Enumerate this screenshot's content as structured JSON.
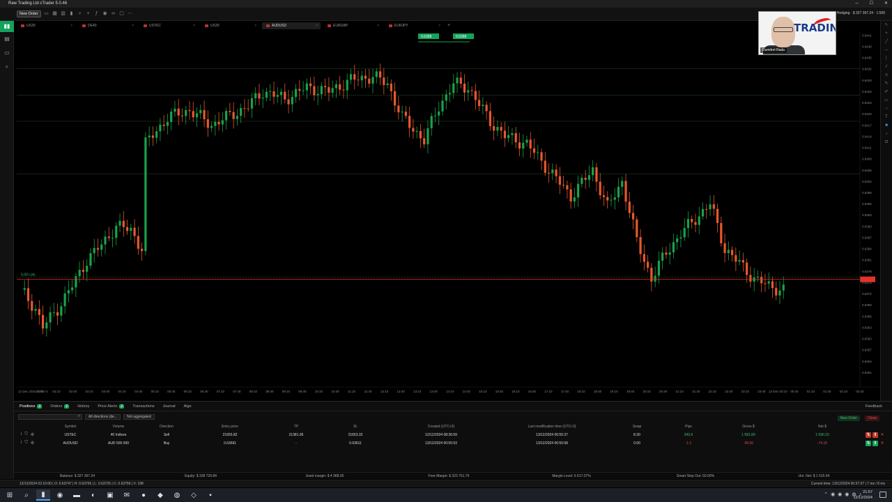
{
  "window": {
    "title": "Raw Trading Ltd cTrader 5.0.46"
  },
  "toolbar": {
    "new_order_label": "New Order",
    "account_text": "Hedging · $ 327 397.24 · 1:500"
  },
  "tabs": [
    {
      "label": "US30",
      "active": false
    },
    {
      "label": "DE40",
      "active": false
    },
    {
      "label": "USTEC",
      "active": false
    },
    {
      "label": "US30",
      "active": false
    },
    {
      "label": "AUDUSD",
      "active": true
    },
    {
      "label": "EURGBP",
      "active": false
    },
    {
      "label": "EURJPY",
      "active": false
    }
  ],
  "webcam": {
    "name_tag": "Dumitrel Rada",
    "logo_text": "TRADING"
  },
  "chart_data": {
    "type": "candlestick",
    "symbol": "AUDUSD",
    "bar_count": 208,
    "ylim": [
      0.6348,
      0.6442
    ],
    "color_up": "#17a34a",
    "color_down": "#e8582e",
    "current_price_line": 0.63758,
    "price_labels": [
      "0.6441",
      "0.6438",
      "0.6435",
      "0.6432",
      "0.6429",
      "0.6426",
      "0.6423",
      "0.6420",
      "0.6417",
      "0.6414",
      "0.6411",
      "0.6408",
      "0.6405",
      "0.6402",
      "0.6399",
      "0.6396",
      "0.6393",
      "0.6390",
      "0.6387",
      "0.6384",
      "0.6381",
      "0.6378",
      "0.6375",
      "0.6372",
      "0.6369",
      "0.6366",
      "0.6363",
      "0.6360",
      "0.6357",
      "0.6354",
      "0.6351"
    ],
    "time_labels": [
      "12 Dec 2024, UTC+3",
      "01:40",
      "02:10",
      "02:40",
      "03:10",
      "03:40",
      "04:10",
      "04:40",
      "05:10",
      "05:40",
      "06:10",
      "06:40",
      "07:10",
      "07:40",
      "08:10",
      "08:40",
      "09:10",
      "09:40",
      "10:10",
      "10:40",
      "11:10",
      "11:40",
      "12:10",
      "12:40",
      "13:10",
      "13:40",
      "14:10",
      "14:40",
      "15:10",
      "15:40",
      "16:10",
      "16:40",
      "17:10",
      "17:40",
      "18:10",
      "18:40",
      "19:10",
      "19:40",
      "20:10",
      "20:40",
      "21:10",
      "21:40",
      "22:10",
      "22:40",
      "23:10",
      "23:40",
      "13 Dec 00:10",
      "00:40",
      "01:10",
      "01:40",
      "02:10",
      "02:40"
    ],
    "order_line_label": "5.00 Lots",
    "order_tags": [
      "0.6368",
      "0.6368"
    ],
    "anchors": [
      [
        0,
        0.6373
      ],
      [
        4,
        0.6368
      ],
      [
        6,
        0.6363
      ],
      [
        10,
        0.6368
      ],
      [
        14,
        0.6374
      ],
      [
        18,
        0.6381
      ],
      [
        22,
        0.6385
      ],
      [
        26,
        0.639
      ],
      [
        30,
        0.6389
      ],
      [
        33,
        0.6384
      ],
      [
        34,
        0.6412
      ],
      [
        40,
        0.6419
      ],
      [
        46,
        0.6421
      ],
      [
        52,
        0.6417
      ],
      [
        58,
        0.642
      ],
      [
        62,
        0.6422
      ],
      [
        66,
        0.6426
      ],
      [
        72,
        0.6424
      ],
      [
        78,
        0.6427
      ],
      [
        84,
        0.6426
      ],
      [
        90,
        0.6429
      ],
      [
        96,
        0.643
      ],
      [
        100,
        0.6428
      ],
      [
        104,
        0.6419
      ],
      [
        110,
        0.6413
      ],
      [
        114,
        0.6422
      ],
      [
        118,
        0.6428
      ],
      [
        122,
        0.6427
      ],
      [
        128,
        0.6418
      ],
      [
        132,
        0.6414
      ],
      [
        138,
        0.6412
      ],
      [
        144,
        0.6405
      ],
      [
        150,
        0.6398
      ],
      [
        156,
        0.6405
      ],
      [
        160,
        0.6395
      ],
      [
        164,
        0.6402
      ],
      [
        168,
        0.6386
      ],
      [
        172,
        0.6376
      ],
      [
        176,
        0.6383
      ],
      [
        180,
        0.6388
      ],
      [
        184,
        0.6392
      ],
      [
        188,
        0.6396
      ],
      [
        192,
        0.6384
      ],
      [
        196,
        0.638
      ],
      [
        200,
        0.6376
      ],
      [
        204,
        0.6374
      ],
      [
        208,
        0.6373
      ],
      [
        212,
        0.6365
      ],
      [
        216,
        0.6361
      ],
      [
        220,
        0.6363
      ],
      [
        224,
        0.636
      ],
      [
        228,
        0.6364
      ],
      [
        232,
        0.6369
      ]
    ]
  },
  "panel": {
    "tabs": [
      {
        "label": "Positions",
        "count": "2"
      },
      {
        "label": "Orders",
        "count": "2"
      },
      {
        "label": "History",
        "count": ""
      },
      {
        "label": "Price Alerts",
        "count": "2"
      },
      {
        "label": "Transactions",
        "count": ""
      },
      {
        "label": "Journal",
        "count": ""
      },
      {
        "label": "Algo",
        "count": ""
      }
    ],
    "feedback": "Feedback",
    "filter_direction": "All directions (de...",
    "filter_aggregation": "Not aggregated",
    "new_order_label": "New Order",
    "close_label": "Close",
    "columns": [
      "Symbol",
      "Volume",
      "Direction",
      "Entry price",
      "TP",
      "SL",
      "Created (UTC+3)",
      "Last modification time (UTC+3)",
      "Swap",
      "Pips",
      "Gross $",
      "Net $"
    ],
    "rows": [
      {
        "symbol": "USTEC",
        "volume": "40 Indices",
        "direction": "Sell",
        "entry": "21655.82",
        "tp": "21381.95",
        "sl": "21653.32",
        "created": "12/12/2024 08:36:59",
        "modified": "13/12/2024 00:55:37",
        "swap": "8.30",
        "pips": "343.6",
        "gross": "1 581.80",
        "net": "1 590.10",
        "pos": true
      },
      {
        "symbol": "AUDUSD",
        "volume": "AUD 500 000",
        "direction": "Buy",
        "entry": "0.63691",
        "tp": "-",
        "sl": "0.63611",
        "created": "13/12/2024 00:55:53",
        "modified": "13/12/2024 00:55:58",
        "swap": "0.00",
        "pips": "-1.1",
        "gross": "-55.00",
        "net": "-74.16",
        "pos": false
      }
    ]
  },
  "summary": {
    "balance": "Balance: $ 327 397.24",
    "equity": "Equity: $ 328 726.84",
    "used_margin": "Used margin: $ 4 968.05",
    "free_margin": "Free Margin: $ 323 761.79",
    "margin_level": "Margin Level: 6 617.07%",
    "smart_stop": "Smart Stop Out: 50.00%",
    "unr_net": "Unr. Net: $ 1 515.94"
  },
  "status": {
    "ohlc": "12/12/2024 02:10:00 | O: 0.63747 | H: 0.63756 | L: 0.63725 | C: 0.63756 | V: 198",
    "current_time": "Current time: 13/12/2024 00:57:37 | 7 ms / 8 ms"
  },
  "taskbar": {
    "time": "21:57",
    "date": "12/12/2024"
  }
}
